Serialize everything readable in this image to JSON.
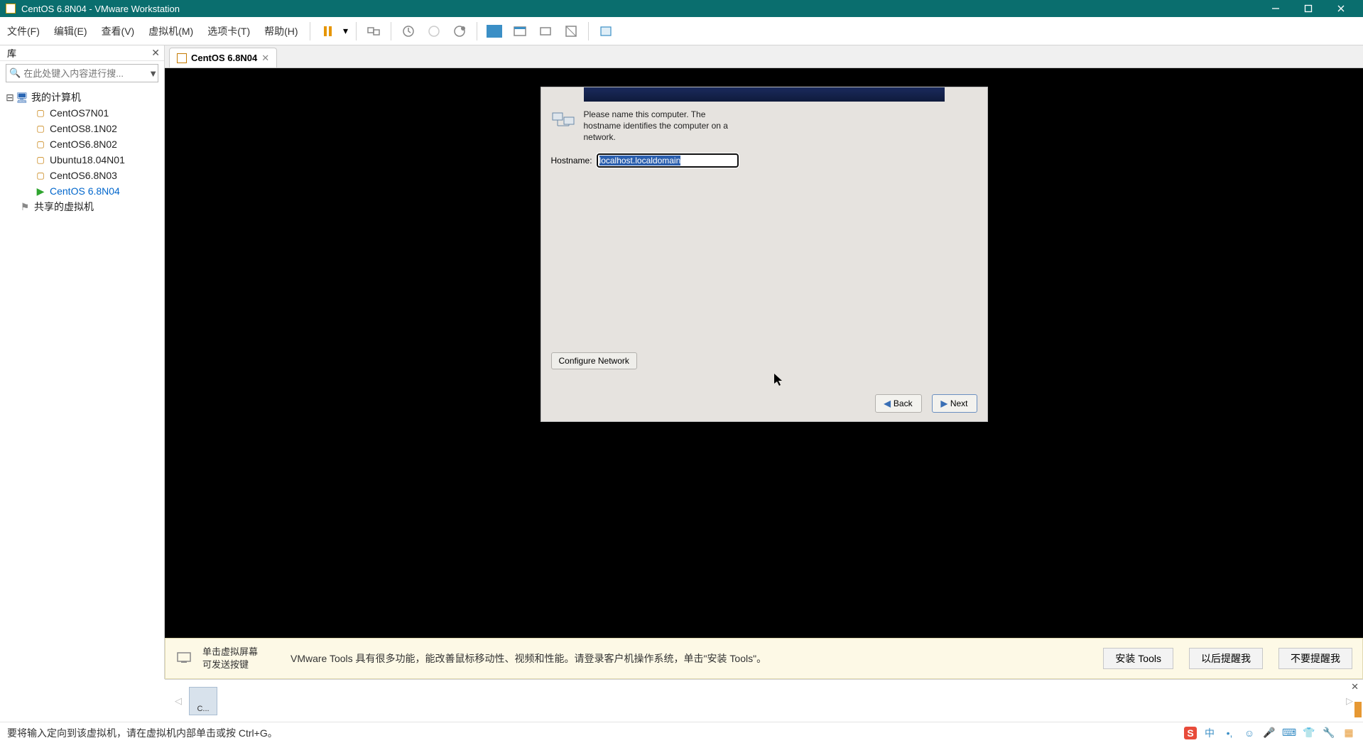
{
  "titlebar": {
    "title": "CentOS 6.8N04 - VMware Workstation"
  },
  "menu": {
    "items": [
      "文件(F)",
      "编辑(E)",
      "查看(V)",
      "虚拟机(M)",
      "选项卡(T)",
      "帮助(H)"
    ]
  },
  "sidebar": {
    "title": "库",
    "search_placeholder": "在此处键入内容进行搜...",
    "root": "我的计算机",
    "vms": [
      {
        "label": "CentOS7N01",
        "running": false
      },
      {
        "label": "CentOS8.1N02",
        "running": false
      },
      {
        "label": "CentOS6.8N02",
        "running": false
      },
      {
        "label": "Ubuntu18.04N01",
        "running": false
      },
      {
        "label": "CentOS6.8N03",
        "running": false
      },
      {
        "label": "CentOS 6.8N04",
        "running": true,
        "active": true
      }
    ],
    "shared": "共享的虚拟机"
  },
  "tab": {
    "label": "CentOS 6.8N04"
  },
  "guest": {
    "desc": "Please name this computer.  The hostname identifies the computer on a network.",
    "hostname_label": "Hostname:",
    "hostname_value": "localhost.localdomain",
    "configure_network": "Configure Network",
    "back": "Back",
    "next": "Next"
  },
  "hint": {
    "left_line1": "单击虚拟屏幕",
    "left_line2": "可发送按键",
    "main": "VMware Tools 具有很多功能，能改善鼠标移动性、视频和性能。请登录客户机操作系统，单击\"安装 Tools\"。",
    "btn_install": "安装 Tools",
    "btn_later": "以后提醒我",
    "btn_never": "不要提醒我"
  },
  "thumb": {
    "label": "C..."
  },
  "status": {
    "text": "要将输入定向到该虚拟机，请在虚拟机内部单击或按 Ctrl+G。"
  },
  "ime": {
    "lang": "中"
  }
}
